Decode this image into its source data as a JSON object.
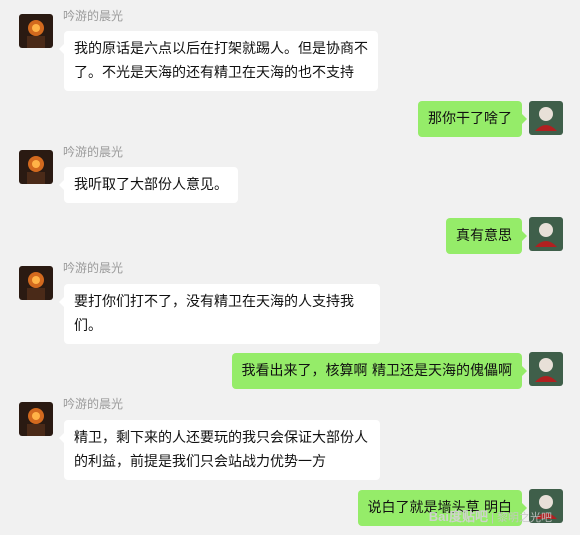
{
  "sender_name": "吟游的晨光",
  "messages": [
    {
      "side": "in",
      "text": "我的原话是六点以后在打架就踢人。但是协商不了。不光是天海的还有精卫在天海的也不支持"
    },
    {
      "side": "out",
      "text": "那你干了啥了"
    },
    {
      "side": "in",
      "text": "我听取了大部份人意见。"
    },
    {
      "side": "out",
      "text": "真有意思"
    },
    {
      "side": "in",
      "text": "要打你们打不了，没有精卫在天海的人支持我们。"
    },
    {
      "side": "out",
      "text": "我看出来了，核算啊 精卫还是天海的傀儡啊"
    },
    {
      "side": "in",
      "text": "精卫，剩下来的人还要玩的我只会保证大部份人的利益，前提是我们只会站战力优势一方"
    },
    {
      "side": "out",
      "text": "说白了就是墙头草 明白"
    }
  ],
  "watermark": {
    "brand": "Bai度贴吧",
    "divider": "|",
    "text": "黎明之光吧"
  },
  "colors": {
    "background": "#f1f1f1",
    "incoming_bubble": "#ffffff",
    "outgoing_bubble": "#95ec69"
  }
}
